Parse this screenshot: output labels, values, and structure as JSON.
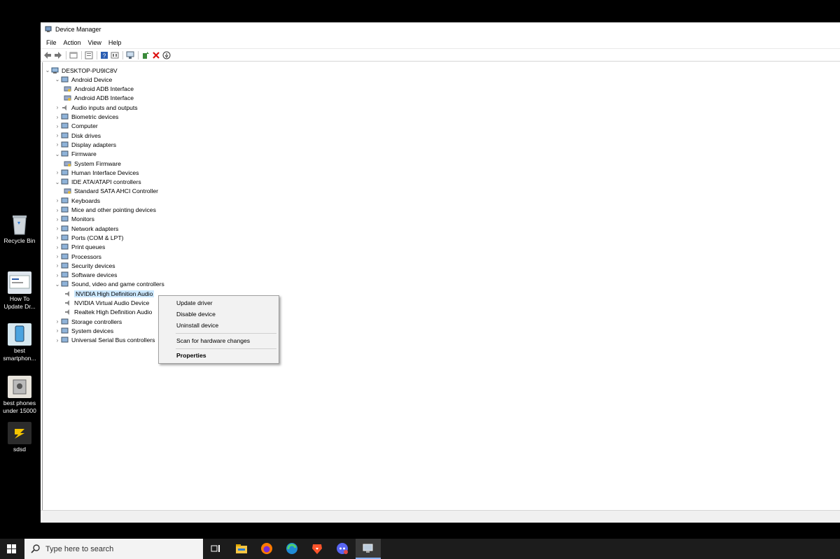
{
  "desktop": {
    "icons": [
      {
        "label": "Recycle Bin",
        "icon": "recycle-bin-icon"
      },
      {
        "label": "How To Update Dr...",
        "icon": "shortcut-image-icon"
      },
      {
        "label": "best smartphon...",
        "icon": "shortcut-image-icon"
      },
      {
        "label": "best phones under 15000",
        "icon": "shortcut-image-icon"
      },
      {
        "label": "sdsd",
        "icon": "app-shortcut-icon"
      }
    ]
  },
  "window": {
    "title": "Device Manager",
    "menu": [
      "File",
      "Action",
      "View",
      "Help"
    ],
    "toolbar_icons": [
      "back-arrow-icon",
      "forward-arrow-icon",
      "properties-pane-icon",
      "view-list-icon",
      "help-icon",
      "view-details-icon",
      "scan-hardware-icon",
      "add-driver-icon",
      "uninstall-x-icon",
      "disable-device-icon"
    ]
  },
  "tree": {
    "root": "DESKTOP-PU9IC8V",
    "items": [
      {
        "label": "Android Device",
        "expanded": true
      },
      {
        "label": "Android ADB Interface",
        "child": true
      },
      {
        "label": "Android ADB Interface",
        "child": true
      },
      {
        "label": "Audio inputs and outputs"
      },
      {
        "label": "Biometric devices"
      },
      {
        "label": "Computer"
      },
      {
        "label": "Disk drives"
      },
      {
        "label": "Display adapters"
      },
      {
        "label": "Firmware",
        "expanded": true
      },
      {
        "label": "System Firmware",
        "child": true
      },
      {
        "label": "Human Interface Devices"
      },
      {
        "label": "IDE ATA/ATAPI controllers",
        "expanded": true
      },
      {
        "label": "Standard SATA AHCI Controller",
        "child": true
      },
      {
        "label": "Keyboards"
      },
      {
        "label": "Mice and other pointing devices"
      },
      {
        "label": "Monitors"
      },
      {
        "label": "Network adapters"
      },
      {
        "label": "Ports (COM & LPT)"
      },
      {
        "label": "Print queues"
      },
      {
        "label": "Processors"
      },
      {
        "label": "Security devices"
      },
      {
        "label": "Software devices"
      },
      {
        "label": "Sound, video and game controllers",
        "expanded": true
      },
      {
        "label": "NVIDIA High Definition Audio",
        "child": true,
        "selected": true
      },
      {
        "label": "NVIDIA Virtual Audio Device",
        "child": true
      },
      {
        "label": "Realtek High Definition Audio",
        "child": true
      },
      {
        "label": "Storage controllers"
      },
      {
        "label": "System devices"
      },
      {
        "label": "Universal Serial Bus controllers"
      }
    ]
  },
  "context_menu": {
    "items": [
      "Update driver",
      "Disable device",
      "Uninstall device",
      "Scan for hardware changes",
      "Properties"
    ]
  },
  "taskbar": {
    "search_placeholder": "Type here to search",
    "apps": [
      "task-view-icon",
      "file-explorer-icon",
      "firefox-icon",
      "edge-icon",
      "brave-icon",
      "discord-icon",
      "device-manager-icon"
    ]
  },
  "colors": {
    "selection": "#cce8ff",
    "taskbar": "#1c1c1c",
    "window": "#ffffff"
  }
}
